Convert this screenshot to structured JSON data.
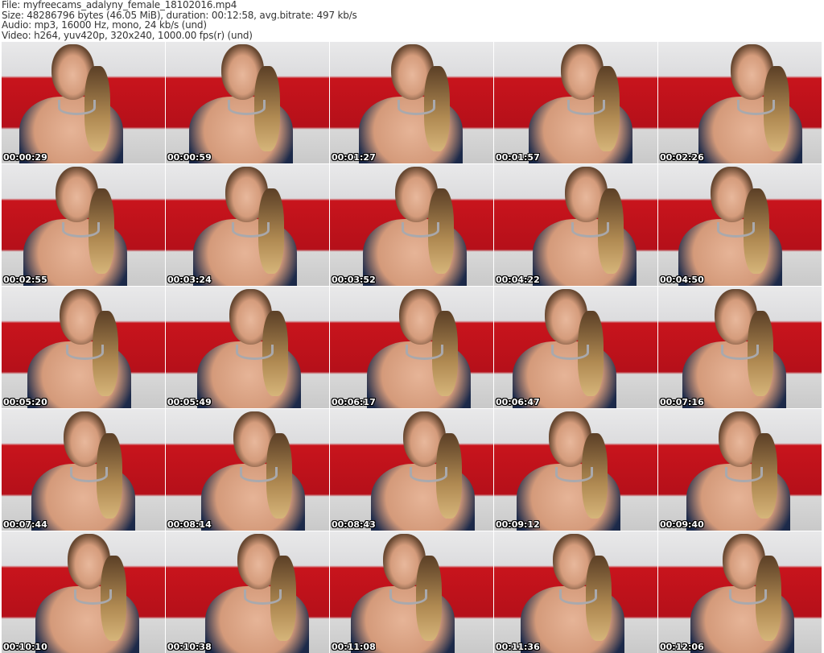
{
  "header": {
    "file": "File: myfreecams_adalyny_female_18102016.mp4",
    "size": "Size: 48286796 bytes (46.05 MiB), duration: 00:12:58, avg.bitrate: 497 kb/s",
    "audio": "Audio: mp3, 16000 Hz, mono, 24 kb/s (und)",
    "video": "Video: h264, yuv420p, 320x240, 1000.00 fps(r) (und)"
  },
  "thumbnails": [
    "00:00:29",
    "00:00:59",
    "00:01:27",
    "00:01:57",
    "00:02:26",
    "00:02:55",
    "00:03:24",
    "00:03:52",
    "00:04:22",
    "00:04:50",
    "00:05:20",
    "00:05:49",
    "00:06:17",
    "00:06:47",
    "00:07:16",
    "00:07:44",
    "00:08:14",
    "00:08:43",
    "00:09:12",
    "00:09:40",
    "00:10:10",
    "00:10:38",
    "00:11:08",
    "00:11:36",
    "00:12:06"
  ]
}
